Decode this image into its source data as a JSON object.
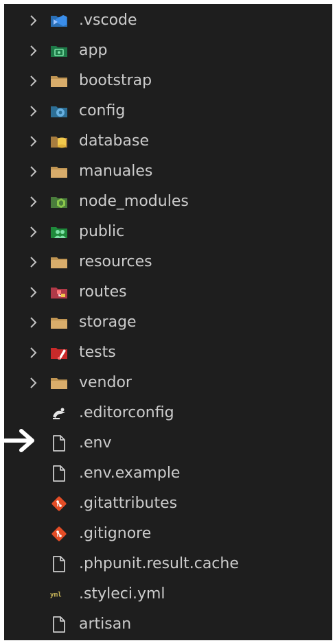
{
  "explorer": {
    "items": [
      {
        "label": ".vscode",
        "kind": "folder",
        "icon": "vscode-folder-icon",
        "color": "#3b8eea"
      },
      {
        "label": "app",
        "kind": "folder",
        "icon": "app-folder-icon",
        "color": "#1e9e5a"
      },
      {
        "label": "bootstrap",
        "kind": "folder",
        "icon": "folder-icon",
        "color": "#c09553"
      },
      {
        "label": "config",
        "kind": "folder",
        "icon": "config-folder-icon",
        "color": "#3c8dbc"
      },
      {
        "label": "database",
        "kind": "folder",
        "icon": "database-folder-icon",
        "color": "#c09553"
      },
      {
        "label": "manuales",
        "kind": "folder",
        "icon": "folder-icon",
        "color": "#c09553"
      },
      {
        "label": "node_modules",
        "kind": "folder",
        "icon": "node-folder-icon",
        "color": "#5fa04e"
      },
      {
        "label": "public",
        "kind": "folder",
        "icon": "public-folder-icon",
        "color": "#2ea043"
      },
      {
        "label": "resources",
        "kind": "folder",
        "icon": "folder-icon",
        "color": "#c09553"
      },
      {
        "label": "routes",
        "kind": "folder",
        "icon": "routes-folder-icon",
        "color": "#d9534f"
      },
      {
        "label": "storage",
        "kind": "folder",
        "icon": "folder-icon",
        "color": "#c09553"
      },
      {
        "label": "tests",
        "kind": "folder",
        "icon": "tests-folder-icon",
        "color": "#e03131"
      },
      {
        "label": "vendor",
        "kind": "folder",
        "icon": "folder-icon",
        "color": "#c09553"
      },
      {
        "label": ".editorconfig",
        "kind": "file",
        "icon": "editorconfig-icon",
        "color": "#e6e6e6"
      },
      {
        "label": ".env",
        "kind": "file",
        "icon": "file-icon",
        "color": "#cccccc"
      },
      {
        "label": ".env.example",
        "kind": "file",
        "icon": "file-icon",
        "color": "#cccccc"
      },
      {
        "label": ".gitattributes",
        "kind": "file",
        "icon": "git-icon",
        "color": "#e44d26"
      },
      {
        "label": ".gitignore",
        "kind": "file",
        "icon": "git-icon",
        "color": "#e44d26"
      },
      {
        "label": ".phpunit.result.cache",
        "kind": "file",
        "icon": "file-icon",
        "color": "#cccccc"
      },
      {
        "label": ".styleci.yml",
        "kind": "file",
        "icon": "yml-icon",
        "color": "#c5b358"
      },
      {
        "label": "artisan",
        "kind": "file",
        "icon": "file-icon",
        "color": "#cccccc"
      }
    ]
  },
  "annotation": {
    "icon": "right-arrow-icon",
    "points_to": ".env",
    "color": "#ffffff"
  }
}
